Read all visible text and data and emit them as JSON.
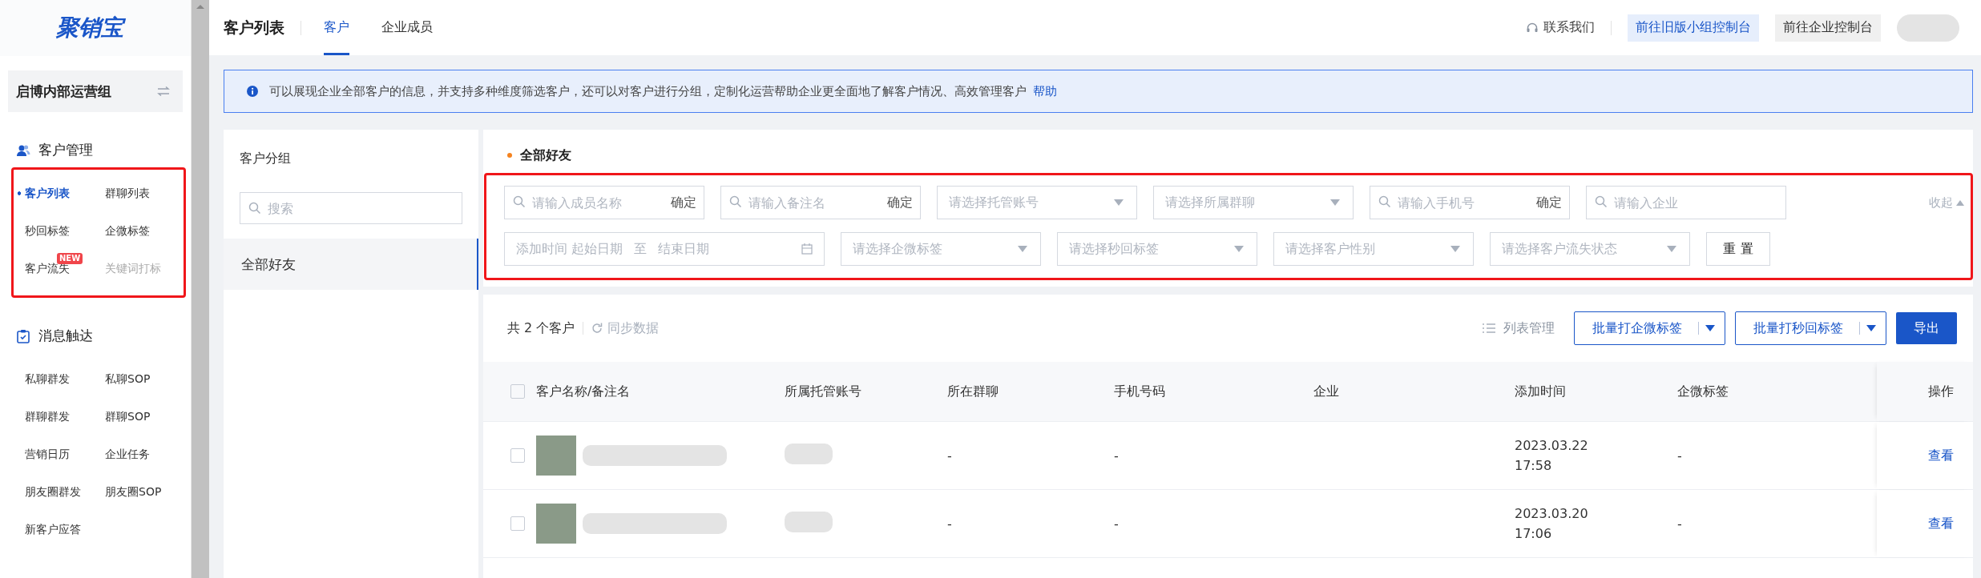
{
  "logo": "聚销宝",
  "sidebar": {
    "group": "启博内部运营组",
    "sections": [
      {
        "title": "客户管理",
        "highlighted": true,
        "items": [
          {
            "label": "客户列表",
            "selected": true,
            "disabled": false
          },
          {
            "label": "群聊列表",
            "selected": false,
            "disabled": false
          },
          {
            "label": "秒回标签",
            "selected": false,
            "disabled": false
          },
          {
            "label": "企微标签",
            "selected": false,
            "disabled": false
          },
          {
            "label": "客户流失",
            "selected": false,
            "disabled": false,
            "badge": "NEW"
          },
          {
            "label": "关键词打标",
            "selected": false,
            "disabled": true
          }
        ]
      },
      {
        "title": "消息触达",
        "items": [
          {
            "label": "私聊群发",
            "selected": false,
            "disabled": false
          },
          {
            "label": "私聊SOP",
            "selected": false,
            "disabled": false
          },
          {
            "label": "群聊群发",
            "selected": false,
            "disabled": false
          },
          {
            "label": "群聊SOP",
            "selected": false,
            "disabled": false
          },
          {
            "label": "营销日历",
            "selected": false,
            "disabled": false
          },
          {
            "label": "企业任务",
            "selected": false,
            "disabled": false
          },
          {
            "label": "朋友圈群发",
            "selected": false,
            "disabled": false
          },
          {
            "label": "朋友圈SOP",
            "selected": false,
            "disabled": false
          },
          {
            "label": "新客户应答",
            "selected": false,
            "disabled": false
          }
        ]
      }
    ]
  },
  "header": {
    "title": "客户列表",
    "tabs": [
      {
        "label": "客户",
        "selected": true
      },
      {
        "label": "企业成员",
        "selected": false
      }
    ],
    "contact": "联系我们",
    "buttons": [
      {
        "label": "前往旧版小组控制台",
        "kind": "primary"
      },
      {
        "label": "前往企业控制台",
        "kind": "plain"
      }
    ]
  },
  "notice": {
    "text": "可以展现企业全部客户的信息，并支持多种维度筛选客户，还可以对客户进行分组，定制化运营帮助企业更全面地了解客户情况、高效管理客户",
    "link": "帮助"
  },
  "groups": {
    "title": "客户分组",
    "search": {
      "placeholder": "搜索"
    },
    "items": [
      {
        "label": "全部好友",
        "selected": true
      }
    ]
  },
  "filters": {
    "title": "全部好友",
    "highlighted": true,
    "collapse": "收起",
    "rows": [
      [
        {
          "kind": "search",
          "placeholder": "请输入成员名称",
          "action": "确定"
        },
        {
          "kind": "search",
          "placeholder": "请输入备注名",
          "action": "确定"
        },
        {
          "kind": "select",
          "placeholder": "请选择托管账号"
        },
        {
          "kind": "select",
          "placeholder": "请选择所属群聊"
        },
        {
          "kind": "search",
          "placeholder": "请输入手机号",
          "action": "确定"
        },
        {
          "kind": "search",
          "placeholder": "请输入企业"
        }
      ],
      [
        {
          "kind": "daterange",
          "label": "添加时间",
          "start": "起始日期",
          "separator": "至",
          "end": "结束日期"
        },
        {
          "kind": "select",
          "placeholder": "请选择企微标签"
        },
        {
          "kind": "select",
          "placeholder": "请选择秒回标签"
        },
        {
          "kind": "select",
          "placeholder": "请选择客户性别"
        },
        {
          "kind": "select",
          "placeholder": "请选择客户流失状态"
        },
        {
          "kind": "button",
          "label": "重 置"
        }
      ]
    ]
  },
  "toolbar": {
    "count": "共 2 个客户",
    "sync": "同步数据",
    "columns": "列表管理",
    "buttons": [
      {
        "label": "批量打企微标签",
        "kind": "split"
      },
      {
        "label": "批量打秒回标签",
        "kind": "split"
      },
      {
        "label": "导出",
        "kind": "primary"
      }
    ]
  },
  "table": {
    "all_selected": false,
    "columns": [
      "客户名称/备注名",
      "所属托管账号",
      "所在群聊",
      "手机号码",
      "企业",
      "添加时间",
      "企微标签",
      "操作"
    ],
    "rows": [
      {
        "selected": false,
        "group": "-",
        "phone": "-",
        "added_date": "2023.03.22",
        "added_time": "17:58",
        "tag": "-",
        "action": "查看"
      },
      {
        "selected": false,
        "group": "-",
        "phone": "-",
        "added_date": "2023.03.20",
        "added_time": "17:06",
        "tag": "-",
        "action": "查看"
      }
    ]
  }
}
